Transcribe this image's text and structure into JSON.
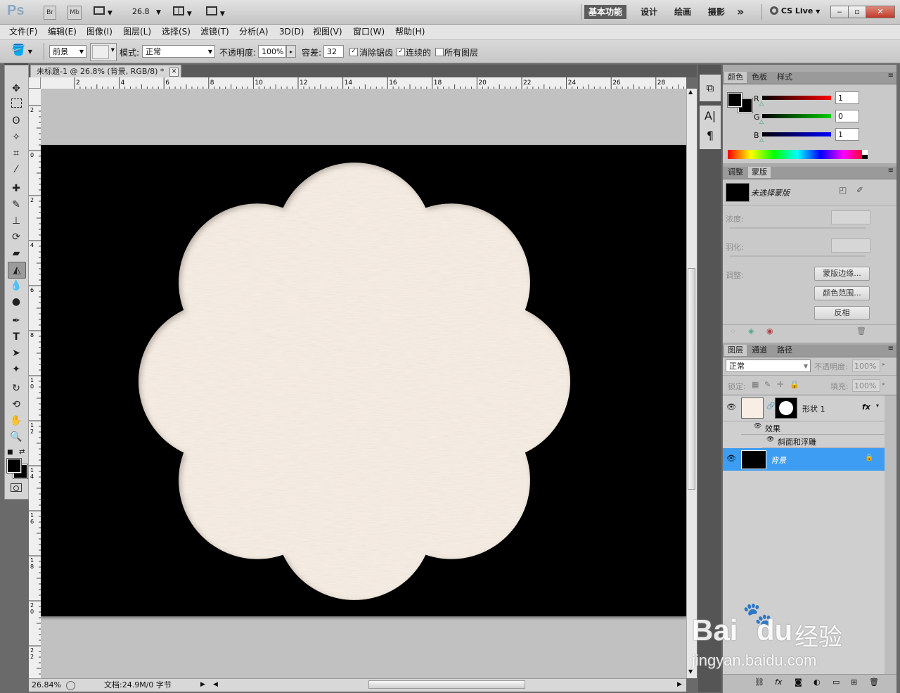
{
  "app": {
    "logo": "Ps",
    "bridge_btn": "Br",
    "minibridge_btn": "Mb",
    "zoom_value": "26.8",
    "workspaces": [
      "基本功能",
      "设计",
      "绘画",
      "摄影"
    ],
    "more": "»",
    "cs_live": "CS Live",
    "win_min": "‒",
    "win_max": "▫",
    "win_close": "✕"
  },
  "menu": [
    "文件(F)",
    "编辑(E)",
    "图像(I)",
    "图层(L)",
    "选择(S)",
    "滤镜(T)",
    "分析(A)",
    "3D(D)",
    "视图(V)",
    "窗口(W)",
    "帮助(H)"
  ],
  "options": {
    "fill_source": "前景",
    "mode_label": "模式:",
    "mode_value": "正常",
    "opacity_label": "不透明度:",
    "opacity_value": "100%",
    "tolerance_label": "容差:",
    "tolerance_value": "32",
    "antialias_label": "消除锯齿",
    "contiguous_label": "连续的",
    "all_layers_label": "所有图层",
    "antialias": true,
    "contiguous": true,
    "all_layers": false
  },
  "document": {
    "tab_title": "未标题-1 @ 26.8% (背景, RGB/8) *",
    "ruler_top_labels": [
      "2",
      "4",
      "6",
      "8",
      "10",
      "12",
      "14",
      "16",
      "18",
      "20",
      "22",
      "24",
      "26",
      "28"
    ],
    "ruler_left_labels": [
      "2",
      "0",
      "2",
      "4",
      "6",
      "8",
      "10",
      "12",
      "14",
      "16",
      "18",
      "20",
      "22"
    ],
    "shape_fill": "#f8eee4",
    "background_color": "#000000"
  },
  "status": {
    "zoom": "26.84%",
    "doc_info": "文档:24.9M/0 字节"
  },
  "color_panel": {
    "tabs": [
      "颜色",
      "色板",
      "样式"
    ],
    "channels": [
      {
        "label": "R",
        "value": "1"
      },
      {
        "label": "G",
        "value": "0"
      },
      {
        "label": "B",
        "value": "1"
      }
    ]
  },
  "masks_panel": {
    "tabs": [
      "调整",
      "蒙版"
    ],
    "title": "未选择蒙版",
    "density_label": "浓度:",
    "feather_label": "羽化:",
    "refine_label": "调整:",
    "mask_edge_btn": "蒙版边缘...",
    "color_range_btn": "颜色范围...",
    "invert_btn": "反相"
  },
  "layers_panel": {
    "tabs": [
      "图层",
      "通道",
      "路径"
    ],
    "blend_mode": "正常",
    "opacity_label": "不透明度:",
    "opacity_value": "100%",
    "lock_label": "锁定:",
    "fill_label": "填充:",
    "fill_value": "100%",
    "layers": [
      {
        "name": "形状 1",
        "fx": "fx",
        "effects_label": "效果",
        "effect": "斜面和浮雕"
      },
      {
        "name": "背景",
        "selected": true
      }
    ]
  },
  "watermark": {
    "brand": "Bai",
    "brand2": "du",
    "cn": "经验",
    "url": "jingyan.baidu.com"
  }
}
